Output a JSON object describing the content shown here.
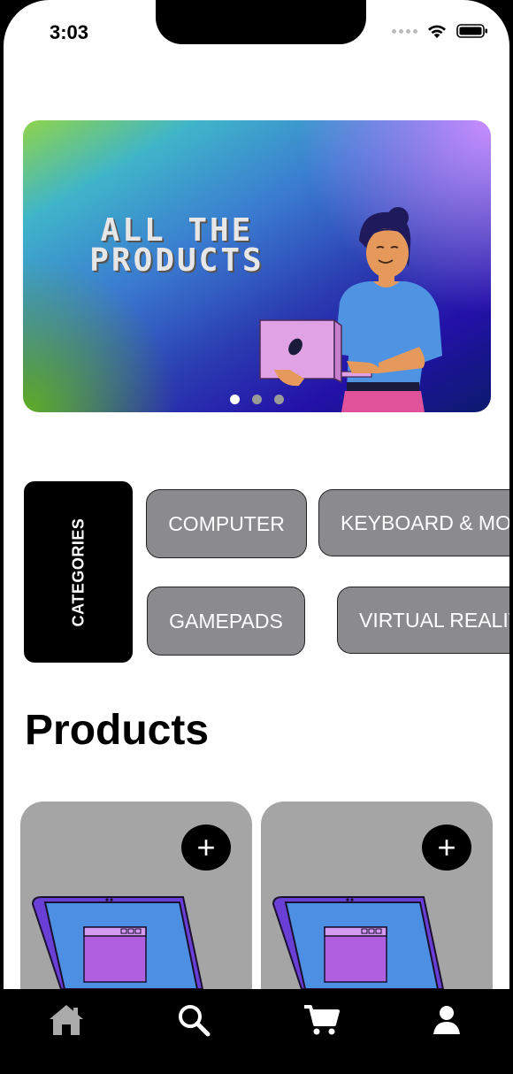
{
  "status_bar": {
    "time": "3:03"
  },
  "banner": {
    "title_line1": "ALL THE",
    "title_line2": "PRODUCTS",
    "pager_count": 3,
    "pager_active": 0
  },
  "categories": {
    "label": "CATEGORIES",
    "items": [
      "COMPUTER",
      "KEYBOARD & MO",
      "GAMEPADS",
      "VIRTUAL REALIT"
    ]
  },
  "products": {
    "heading": "Products",
    "add_label": "+"
  },
  "tabbar": {
    "items": [
      "home-icon",
      "search-icon",
      "cart-icon",
      "profile-icon"
    ]
  },
  "colors": {
    "chip_bg": "#8b8b8d",
    "card_bg": "#a5a5a5",
    "accent": "#000000"
  }
}
